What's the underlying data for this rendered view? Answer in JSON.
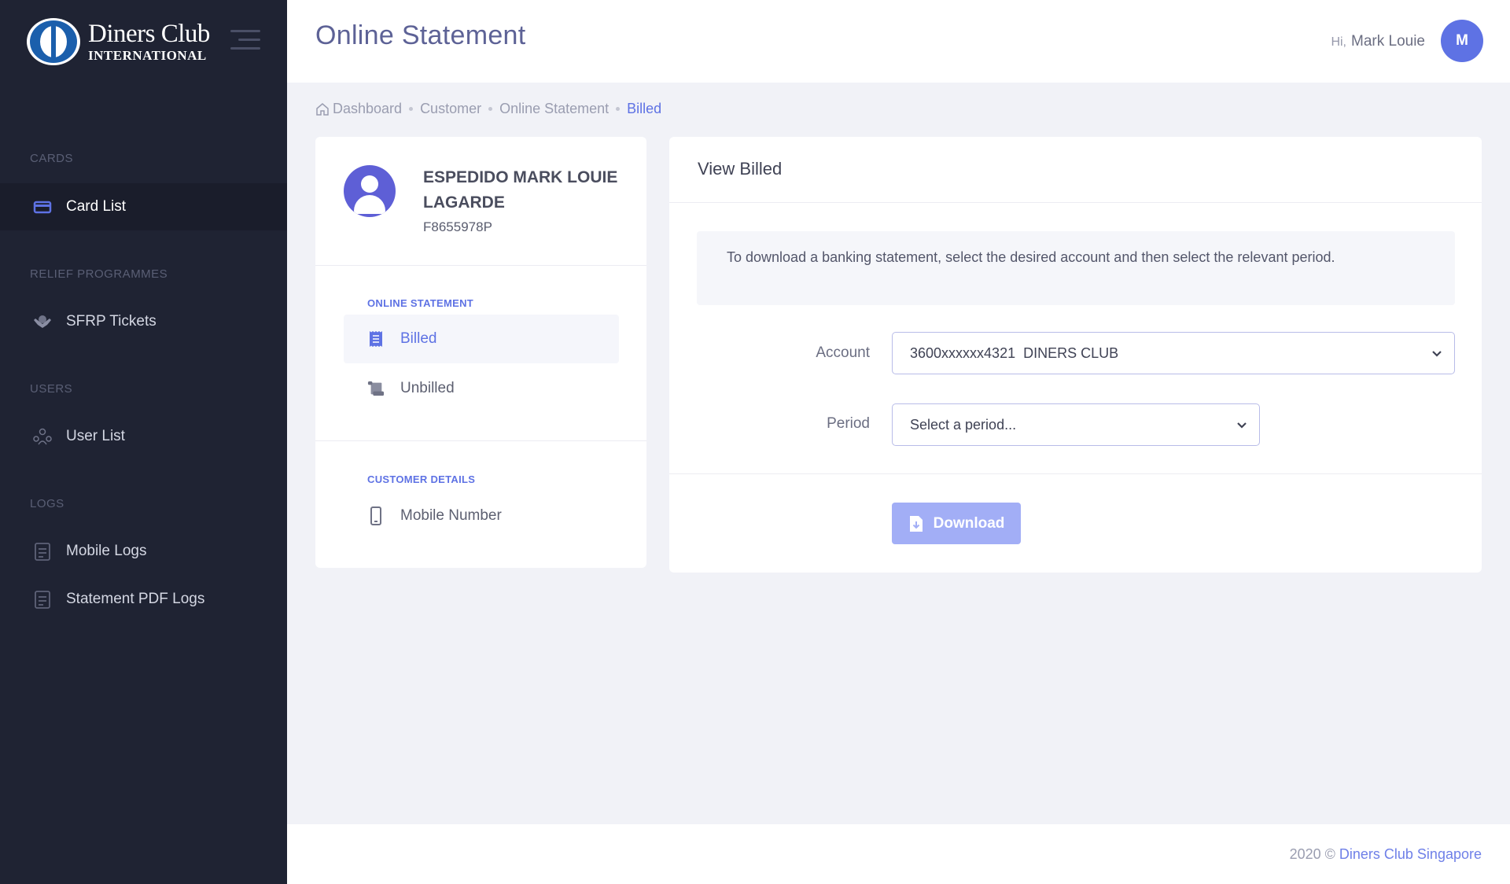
{
  "brand": {
    "line1": "Diners Club",
    "line2": "INTERNATIONAL"
  },
  "header": {
    "title": "Online Statement",
    "greeting": "Hi,",
    "user_name": "Mark Louie",
    "avatar_initial": "M",
    "accent": "#5e72e4"
  },
  "sidebar": {
    "sections": [
      {
        "title": "CARDS",
        "items": [
          {
            "label": "Card List",
            "icon": "card-icon",
            "active": true
          }
        ]
      },
      {
        "title": "RELIEF PROGRAMMES",
        "items": [
          {
            "label": "SFRP Tickets",
            "icon": "hands-icon"
          }
        ]
      },
      {
        "title": "USERS",
        "items": [
          {
            "label": "User List",
            "icon": "users-icon"
          }
        ]
      },
      {
        "title": "LOGS",
        "items": [
          {
            "label": "Mobile Logs",
            "icon": "clipboard-icon"
          },
          {
            "label": "Statement PDF Logs",
            "icon": "clipboard-icon"
          }
        ]
      }
    ]
  },
  "breadcrumb": {
    "items": [
      "Dashboard",
      "Customer",
      "Online Statement"
    ],
    "current": "Billed"
  },
  "profile": {
    "name": "ESPEDIDO MARK LOUIE LAGARDE",
    "id": "F8655978P",
    "online_statement_label": "ONLINE STATEMENT",
    "menu": [
      {
        "label": "Billed",
        "icon": "receipt-icon",
        "active": true
      },
      {
        "label": "Unbilled",
        "icon": "scroll-icon"
      }
    ],
    "customer_details_label": "CUSTOMER DETAILS",
    "details": [
      {
        "label": "Mobile Number",
        "icon": "mobile-icon"
      }
    ]
  },
  "view": {
    "title": "View Billed",
    "info": "To download a banking statement, select the desired account and then select the relevant period.",
    "account_label": "Account",
    "account_value": "3600xxxxxx4321  DINERS CLUB",
    "period_label": "Period",
    "period_placeholder": "Select a period...",
    "download_label": "Download"
  },
  "footer": {
    "year": "2020 ©",
    "company": "Diners Club Singapore"
  }
}
